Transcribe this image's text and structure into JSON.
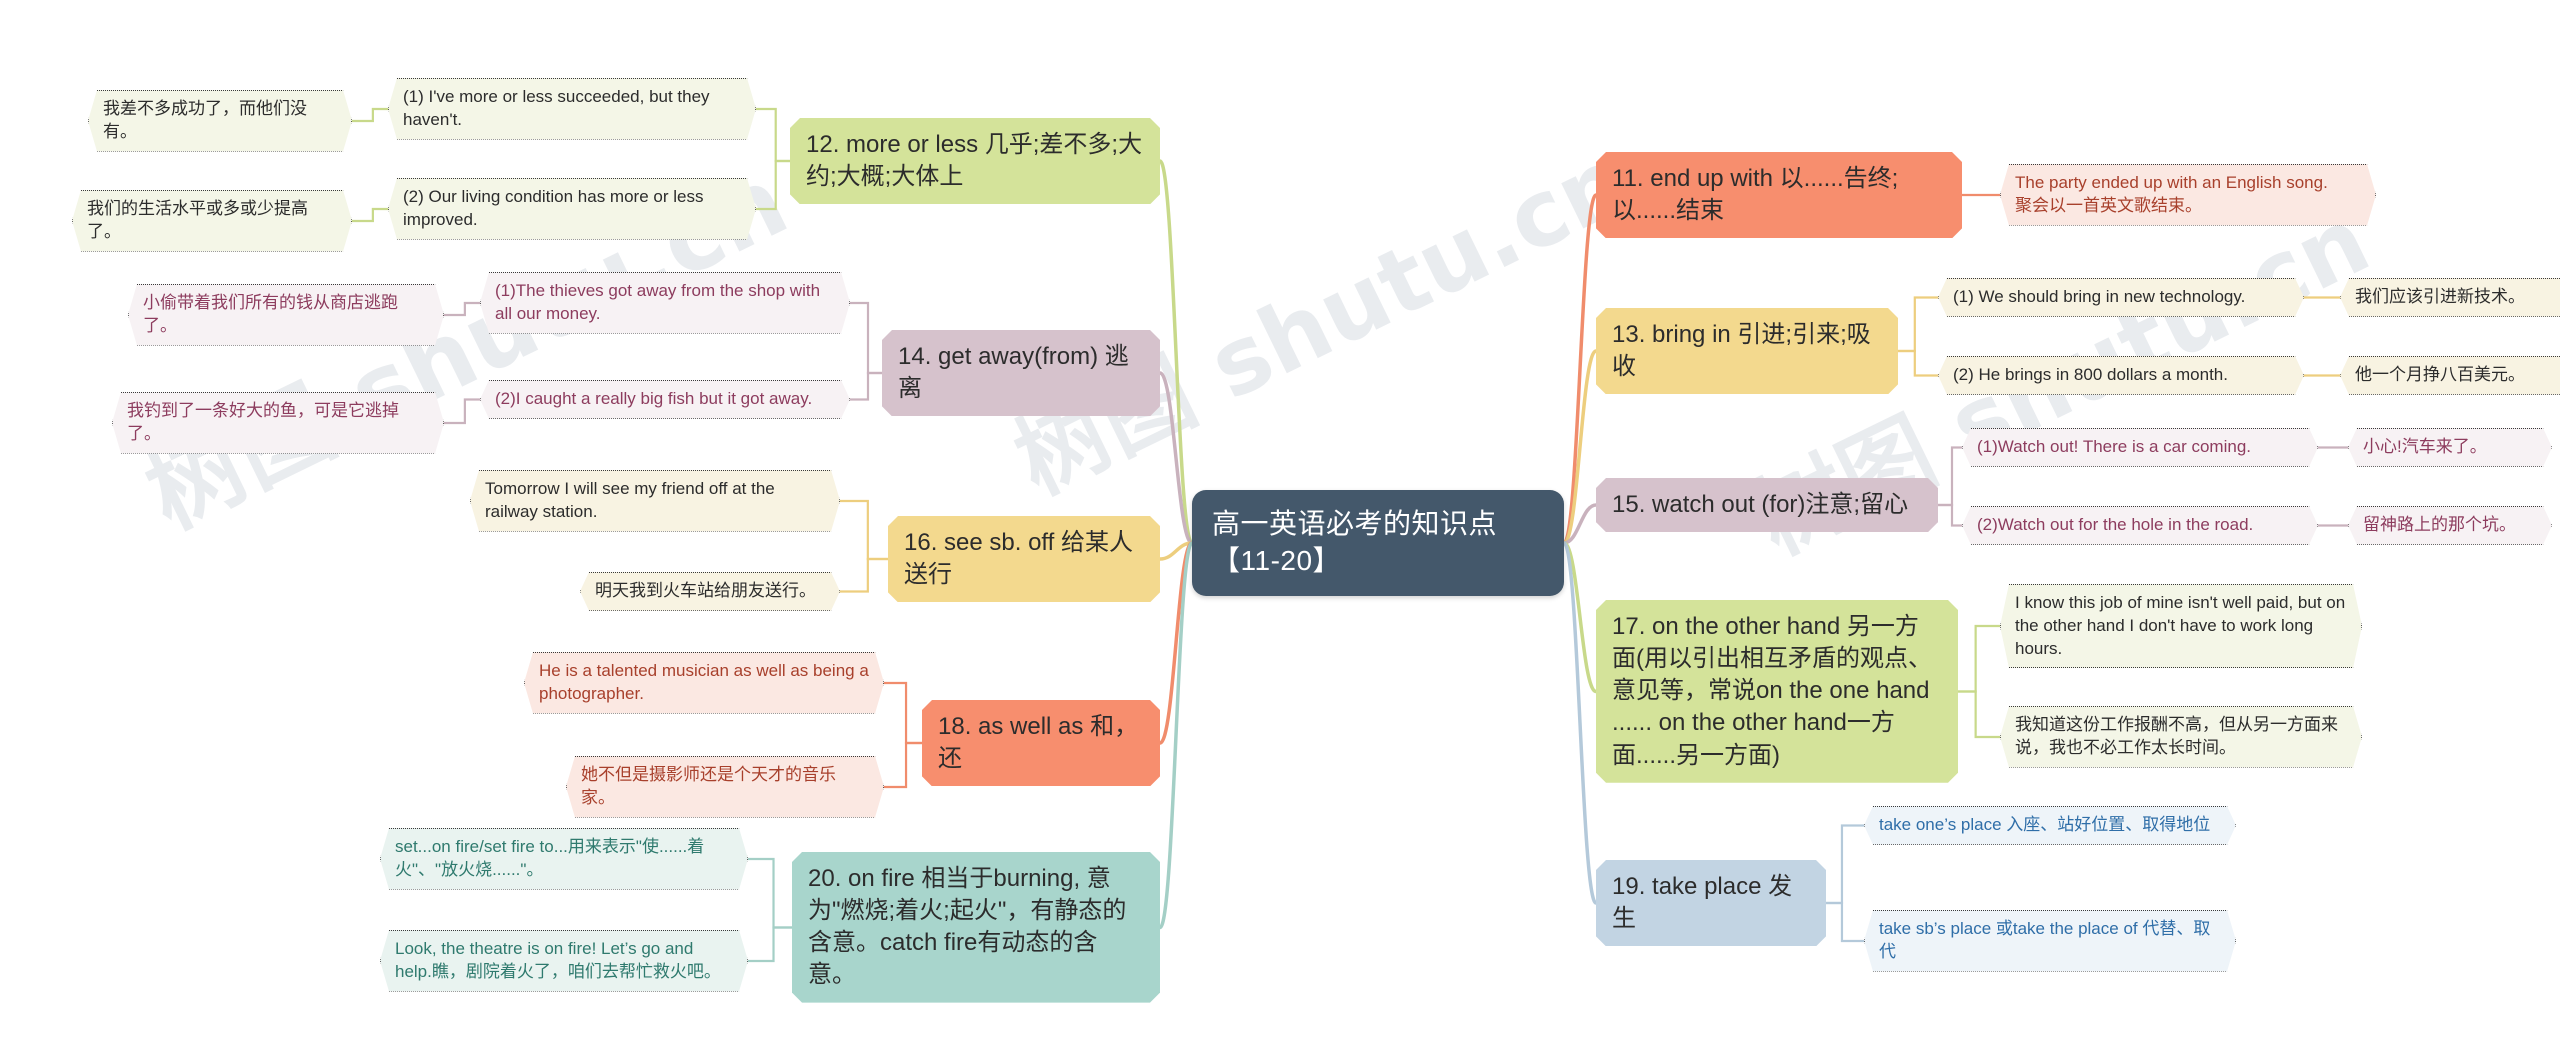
{
  "root": {
    "title": "高一英语必考的知识点【11-20】",
    "color": "#44586b"
  },
  "watermarks": [
    "树图 shutu.cn",
    "树图 shutu.cn",
    "树图 shutu.cn"
  ],
  "topics": [
    {
      "id": "t12",
      "label": "12. more or less 几乎;差不多;大约;大概;大体上",
      "color": "#d4e39a",
      "leafBg": "#f4f6e7",
      "leafText": "#2c2c2c",
      "line": "#c8d98a",
      "children": [
        {
          "label": "(1) I've more or less succeeded, but they haven't.",
          "children": [
            {
              "label": "我差不多成功了，而他们没有。"
            }
          ]
        },
        {
          "label": "(2) Our living condition has more or less improved.",
          "children": [
            {
              "label": "我们的生活水平或多或少提高了。"
            }
          ]
        }
      ]
    },
    {
      "id": "t14",
      "label": "14. get away(from) 逃离",
      "color": "#d6c2cc",
      "leafBg": "#f7f2f4",
      "leafText": "#8d3c5e",
      "line": "#c9b2bd",
      "children": [
        {
          "label": "(1)The thieves got away from the shop with all our money.",
          "children": [
            {
              "label": "小偷带着我们所有的钱从商店逃跑了。"
            }
          ]
        },
        {
          "label": "(2)I caught a really big fish but it got away.",
          "children": [
            {
              "label": "我钓到了一条好大的鱼，可是它逃掉了。"
            }
          ]
        }
      ]
    },
    {
      "id": "t16",
      "label": "16. see sb. off 给某人送行",
      "color": "#f3d98e",
      "leafBg": "#f8f3e2",
      "leafText": "#2c2c2c",
      "line": "#edce7e",
      "children": [
        {
          "label": "Tomorrow I will see my friend off at the railway station."
        },
        {
          "label": "明天我到火车站给朋友送行。"
        }
      ]
    },
    {
      "id": "t18",
      "label": "18. as well as 和，还",
      "color": "#f78e6e",
      "leafBg": "#fbe8e2",
      "leafText": "#a8402c",
      "line": "#f08c6c",
      "children": [
        {
          "label": "He is a talented musician as well as being a photographer."
        },
        {
          "label": "她不但是摄影师还是个天才的音乐家。"
        }
      ]
    },
    {
      "id": "t20",
      "label": "20. on fire 相当于burning, 意为\"燃烧;着火;起火\"，有静态的含意。catch fire有动态的含意。",
      "color": "#a8d5cc",
      "leafBg": "#e9f3f0",
      "leafText": "#2f7a6e",
      "line": "#a4cfc6",
      "children": [
        {
          "label": "set...on fire/set fire to...用来表示\"使......着火\"、\"放火烧......\"。"
        },
        {
          "label": "Look, the theatre is on fire! Let’s go and help.瞧，剧院着火了，咱们去帮忙救火吧。"
        }
      ]
    },
    {
      "id": "t11",
      "label": "11. end up with 以......告终;以......结束",
      "color": "#f78e6e",
      "leafBg": "#fbe8e2",
      "leafText": "#a8402c",
      "line": "#f08c6c",
      "children": [
        {
          "label": "The party ended up with an English song.\n聚会以一首英文歌结束。"
        }
      ]
    },
    {
      "id": "t13",
      "label": "13. bring in 引进;引来;吸收",
      "color": "#f3d98e",
      "leafBg": "#f8f3e2",
      "leafText": "#2c2c2c",
      "line": "#edce7e",
      "children": [
        {
          "label": "(1) We should bring in new technology.",
          "children": [
            {
              "label": "我们应该引进新技术。"
            }
          ]
        },
        {
          "label": "(2) He brings in 800 dollars a month.",
          "children": [
            {
              "label": "他一个月挣八百美元。"
            }
          ]
        }
      ]
    },
    {
      "id": "t15",
      "label": "15. watch out (for)注意;留心",
      "color": "#d6c2cc",
      "leafBg": "#f7f2f4",
      "leafText": "#8d3c5e",
      "line": "#c9b2bd",
      "children": [
        {
          "label": "(1)Watch out! There is a car coming.",
          "children": [
            {
              "label": "小心!汽车来了。"
            }
          ]
        },
        {
          "label": "(2)Watch out for the hole in the road.",
          "children": [
            {
              "label": "留神路上的那个坑。"
            }
          ]
        }
      ]
    },
    {
      "id": "t17",
      "label": "17. on the other hand 另一方面(用以引出相互矛盾的观点、意见等，常说on the one hand ...... on the other hand一方面......另一方面)",
      "color": "#d4e39a",
      "leafBg": "#f4f6e7",
      "leafText": "#2c2c2c",
      "line": "#c8d98a",
      "children": [
        {
          "label": "I know this job of mine isn't well paid, but on the other hand I don't have to work long hours."
        },
        {
          "label": "我知道这份工作报酬不高，但从另一方面来说，我也不必工作太长时间。"
        }
      ]
    },
    {
      "id": "t19",
      "label": "19. take place 发生",
      "color": "#c2d4e3",
      "leafBg": "#eef4f9",
      "leafText": "#2f6ea8",
      "line": "#b4c9da",
      "children": [
        {
          "label": "take one’s place 入座、站好位置、取得地位"
        },
        {
          "label": "take sb’s place 或take the place of 代替、取代"
        }
      ]
    }
  ]
}
